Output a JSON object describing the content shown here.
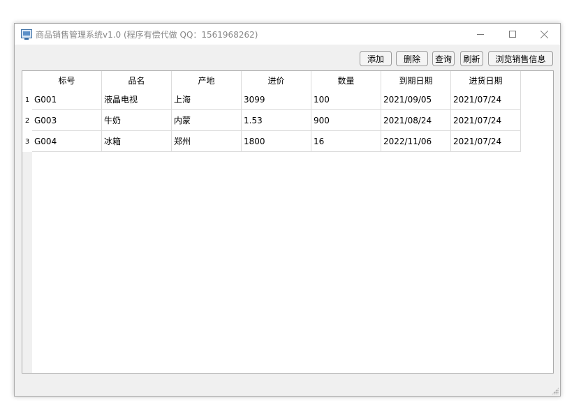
{
  "window": {
    "title": "商品销售管理系统v1.0 (程序有偿代做 QQ：1561968262)"
  },
  "toolbar": {
    "add_label": "添加",
    "delete_label": "删除",
    "query_label": "查询",
    "refresh_label": "刷新",
    "browse_sales_label": "浏览销售信息"
  },
  "table": {
    "columns": [
      "标号",
      "品名",
      "产地",
      "进价",
      "数量",
      "到期日期",
      "进货日期"
    ],
    "rows": [
      {
        "num": "1",
        "cells": [
          "G001",
          "液晶电视",
          "上海",
          "3099",
          "100",
          "2021/09/05",
          "2021/07/24"
        ]
      },
      {
        "num": "2",
        "cells": [
          "G003",
          "牛奶",
          "内蒙",
          "1.53",
          "900",
          "2021/08/24",
          "2021/07/24"
        ]
      },
      {
        "num": "3",
        "cells": [
          "G004",
          "冰箱",
          "郑州",
          "1800",
          "16",
          "2022/11/06",
          "2021/07/24"
        ]
      }
    ]
  }
}
